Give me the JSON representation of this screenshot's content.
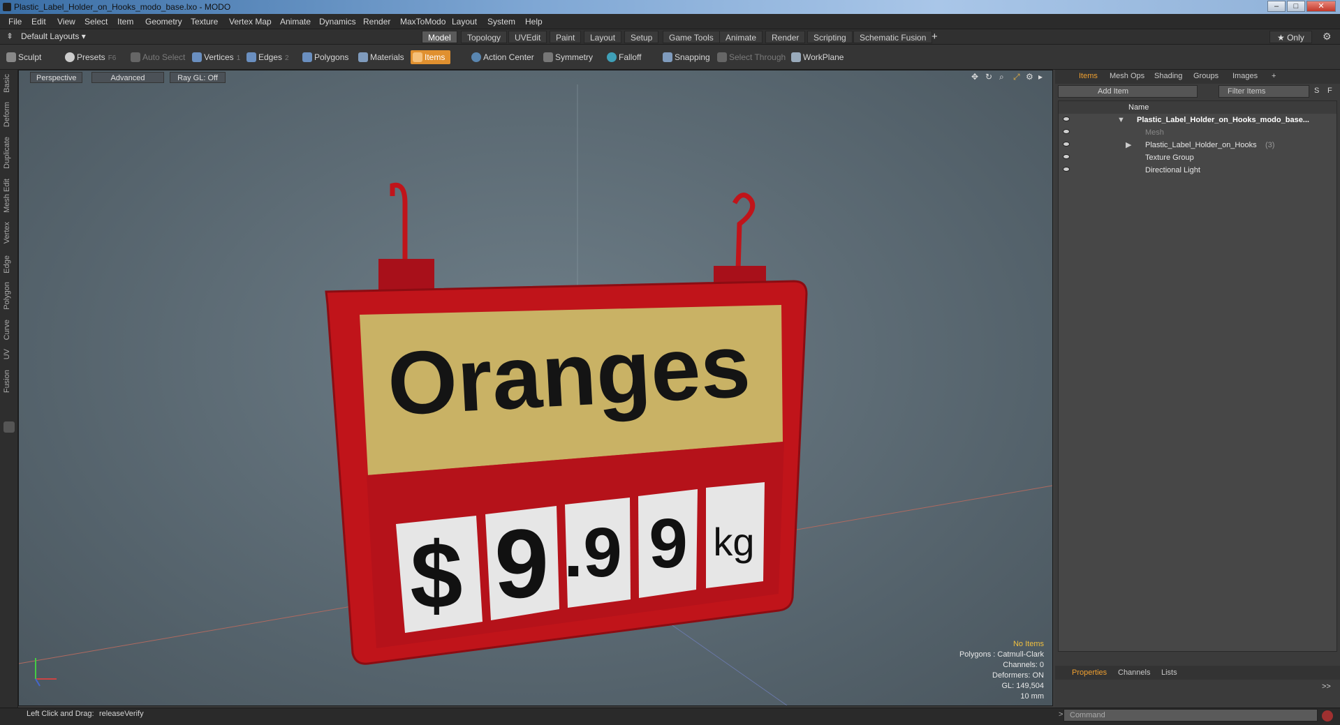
{
  "window": {
    "title": "Plastic_Label_Holder_on_Hooks_modo_base.lxo - MODO"
  },
  "menu": [
    "File",
    "Edit",
    "View",
    "Select",
    "Item",
    "Geometry",
    "Texture",
    "Vertex Map",
    "Animate",
    "Dynamics",
    "Render",
    "MaxToModo",
    "Layout",
    "System",
    "Help"
  ],
  "layouts": {
    "selector": "Default Layouts ▾",
    "tabs": [
      "Model",
      "Topology",
      "UVEdit",
      "Paint",
      "Layout",
      "Setup",
      "Game Tools",
      "Animate",
      "Render",
      "Scripting",
      "Schematic Fusion"
    ],
    "add": "+",
    "only": "★ Only"
  },
  "toolbar": {
    "sculpt": "Sculpt",
    "presets": "Presets",
    "presets_key": "F6",
    "auto_select": "Auto Select",
    "vertices": "Vertices",
    "vertices_key": "1",
    "edges": "Edges",
    "edges_key": "2",
    "polygons": "Polygons",
    "materials": "Materials",
    "items": "Items",
    "action_center": "Action Center",
    "symmetry": "Symmetry",
    "falloff": "Falloff",
    "snapping": "Snapping",
    "select_through": "Select Through",
    "workplane": "WorkPlane"
  },
  "left_tabs": [
    "Basic",
    "Deform",
    "Duplicate",
    "Mesh Edit",
    "Vertex",
    "Edge",
    "Polygon",
    "Curve",
    "UV",
    "Fusion"
  ],
  "viewport": {
    "perspective": "Perspective",
    "advanced": "Advanced",
    "raygl": "Ray GL: Off",
    "sign": {
      "title": "Oranges",
      "digits": [
        "$",
        "9",
        ".9",
        "9",
        "kg"
      ]
    },
    "info": {
      "items": "No Items",
      "polygons": "Polygons : Catmull-Clark",
      "channels": "Channels: 0",
      "deformers": "Deformers: ON",
      "gl": "GL: 149,504",
      "scale": "10 mm"
    }
  },
  "panel": {
    "tabs": [
      "Items",
      "Mesh Ops",
      "Shading",
      "Groups",
      "Images"
    ],
    "add_item": "Add Item",
    "filter": "Filter Items",
    "s_btn": "S",
    "f_btn": "F",
    "col_name": "Name",
    "rows": [
      {
        "label": "Plastic_Label_Holder_on_Hooks_modo_base...",
        "count": ""
      },
      {
        "label": "Mesh",
        "count": ""
      },
      {
        "label": "Plastic_Label_Holder_on_Hooks",
        "count": "(3)"
      },
      {
        "label": "Texture Group",
        "count": ""
      },
      {
        "label": "Directional Light",
        "count": ""
      }
    ],
    "bottom_tabs": [
      "Properties",
      "Channels",
      "Lists"
    ],
    "expand": ">>"
  },
  "status": {
    "hint": "Left Click and Drag:",
    "hint_value": "releaseVerify",
    "command_placeholder": "Command"
  },
  "colors": {
    "accent": "#e0902f",
    "sign_red": "#c0141a",
    "label_yellow": "#c9b265"
  }
}
